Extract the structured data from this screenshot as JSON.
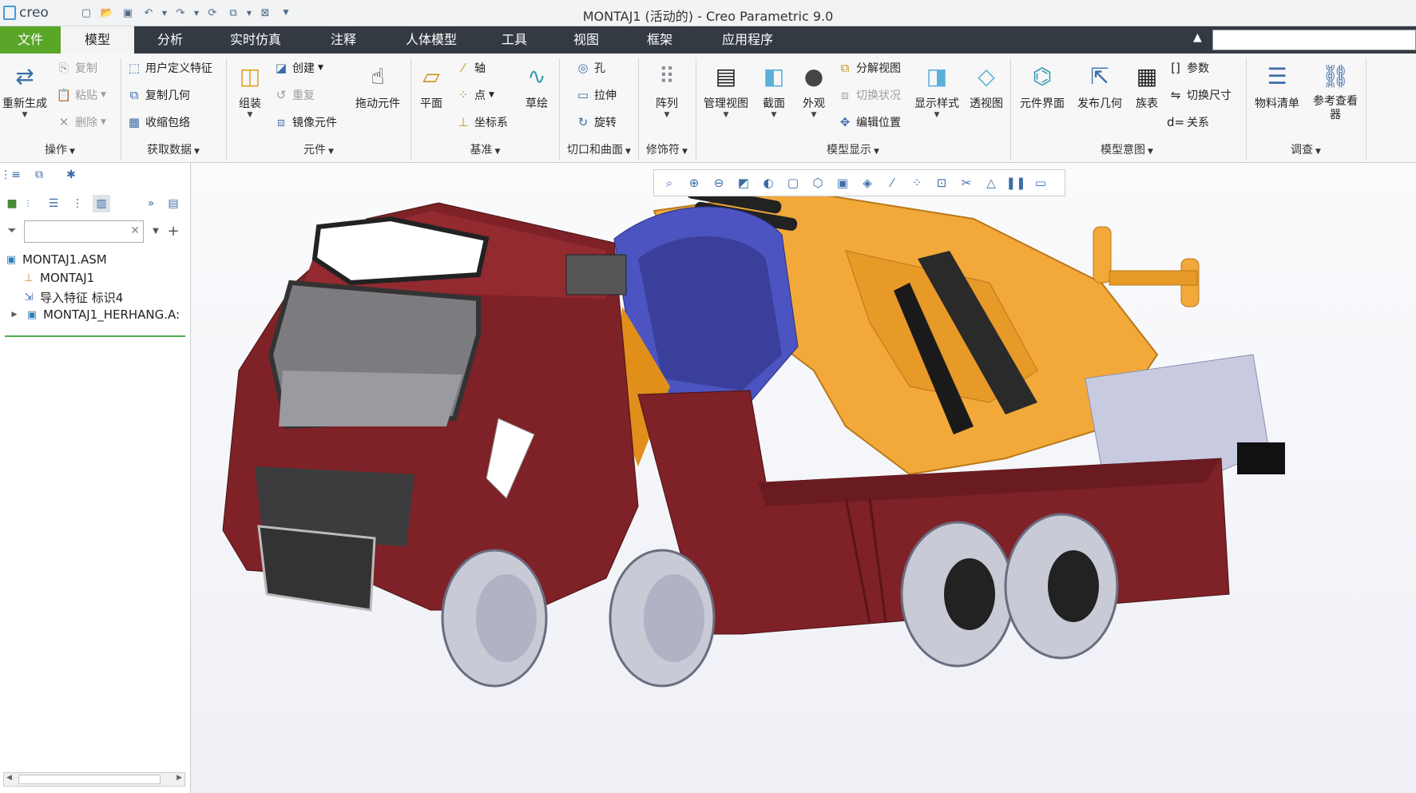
{
  "window": {
    "logo": "creo",
    "title": "MONTAJ1 (活动的) - Creo Parametric 9.0"
  },
  "tabs": [
    {
      "label": "文件"
    },
    {
      "label": "模型"
    },
    {
      "label": "分析"
    },
    {
      "label": "实时仿真"
    },
    {
      "label": "注释"
    },
    {
      "label": "人体模型"
    },
    {
      "label": "工具"
    },
    {
      "label": "视图"
    },
    {
      "label": "框架"
    },
    {
      "label": "应用程序"
    }
  ],
  "ribbon": {
    "ops": {
      "regen": "重新生成",
      "copy": "复制",
      "paste": "粘贴",
      "delete": "删除",
      "group": "操作"
    },
    "getdata": {
      "udf": "用户定义特征",
      "copygeom": "复制几何",
      "shrinkwrap": "收缩包络",
      "group": "获取数据"
    },
    "component": {
      "assemble": "组装",
      "create": "创建",
      "repeat": "重复",
      "mirror": "镜像元件",
      "drag": "拖动元件",
      "group": "元件"
    },
    "datum": {
      "plane": "平面",
      "axis": "轴",
      "point": "点",
      "csys": "坐标系",
      "sketch": "草绘",
      "group": "基准"
    },
    "cut": {
      "hole": "孔",
      "extrude": "拉伸",
      "revolve": "旋转",
      "group": "切口和曲面"
    },
    "modifiers": {
      "pattern": "阵列",
      "group": "修饰符"
    },
    "display": {
      "manageview": "管理视图",
      "section": "截面",
      "appearance": "外观",
      "explode": "分解视图",
      "togglestatus": "切换状况",
      "editpos": "编辑位置",
      "dispstyle": "显示样式",
      "perspective": "透视图",
      "group": "模型显示"
    },
    "intent": {
      "compinterface": "元件界面",
      "publishgeom": "发布几何",
      "familytable": "族表",
      "params": "参数",
      "switchdim": "切换尺寸",
      "relations": "关系",
      "group": "模型意图"
    },
    "investigate": {
      "bom": "物料清单",
      "refviewer": "参考查看器",
      "group": "调查"
    }
  },
  "tree": {
    "root": "MONTAJ1.ASM",
    "items": [
      {
        "label": "MONTAJ1"
      },
      {
        "label": "导入特征 标识4"
      },
      {
        "label": "MONTAJ1_HERHANG.A:"
      }
    ]
  },
  "colors": {
    "accent_file": "#5aa628",
    "tabbar": "#333a42",
    "truck_body": "#7e2227",
    "cab_roof": "#4a53b8",
    "crane": "#f0a530",
    "wheel": "#c8cad6"
  }
}
